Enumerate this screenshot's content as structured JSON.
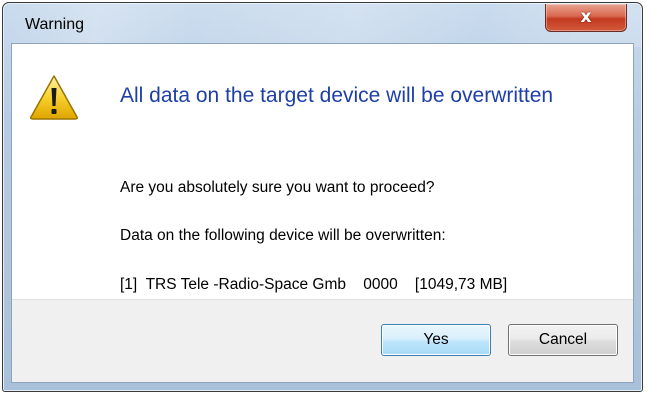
{
  "window": {
    "title": "Warning",
    "close_symbol": "x"
  },
  "dialog": {
    "icon": "warning-icon",
    "main_instruction": "All data on the target device will be overwritten",
    "question": "Are you absolutely sure you want to proceed?",
    "devices_intro": "Data on the following device will be overwritten:",
    "device_line": "[1]  TRS Tele -Radio-Space Gmb    0000    [1049,73 MB]"
  },
  "buttons": {
    "yes_label": "Yes",
    "cancel_label": "Cancel"
  },
  "colors": {
    "instruction_text": "#1e3fa8",
    "close_button": "#c33a20",
    "default_button_border": "#3c7fb1",
    "footer_background": "#f0f0f0"
  }
}
